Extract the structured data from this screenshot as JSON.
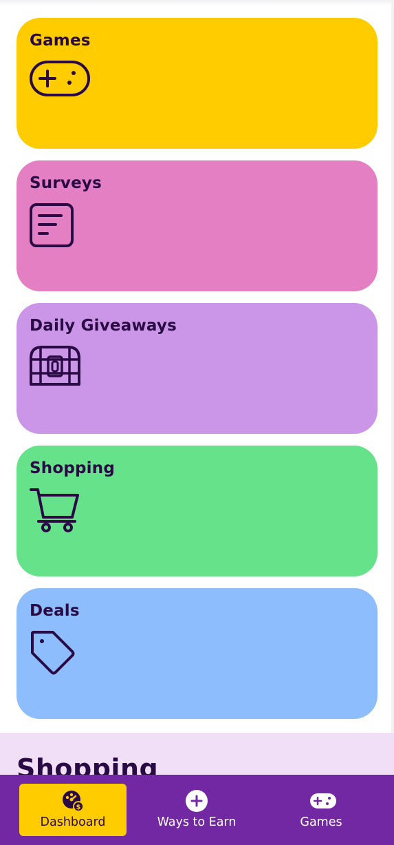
{
  "colors": {
    "ink": "#2a0a45",
    "games_card": "#ffcc00",
    "surveys_card": "#e47fc3",
    "giveaways_card": "#cb96e8",
    "shopping_card": "#66e38a",
    "deals_card": "#8dbdfd",
    "section_bg": "#f0dff6",
    "nav_bg": "#7328a3",
    "nav_active": "#ffcc00"
  },
  "cards": [
    {
      "label": "Games",
      "icon": "gamepad-icon"
    },
    {
      "label": "Surveys",
      "icon": "survey-document-icon"
    },
    {
      "label": "Daily Giveaways",
      "icon": "treasure-chest-icon"
    },
    {
      "label": "Shopping",
      "icon": "shopping-cart-icon"
    },
    {
      "label": "Deals",
      "icon": "price-tag-icon"
    }
  ],
  "section": {
    "title": "Shopping"
  },
  "nav": {
    "items": [
      {
        "label": "Dashboard",
        "icon": "dashboard-dollar-icon",
        "active": true
      },
      {
        "label": "Ways to Earn",
        "icon": "plus-circle-icon",
        "active": false
      },
      {
        "label": "Games",
        "icon": "gamepad-icon",
        "active": false
      }
    ]
  }
}
